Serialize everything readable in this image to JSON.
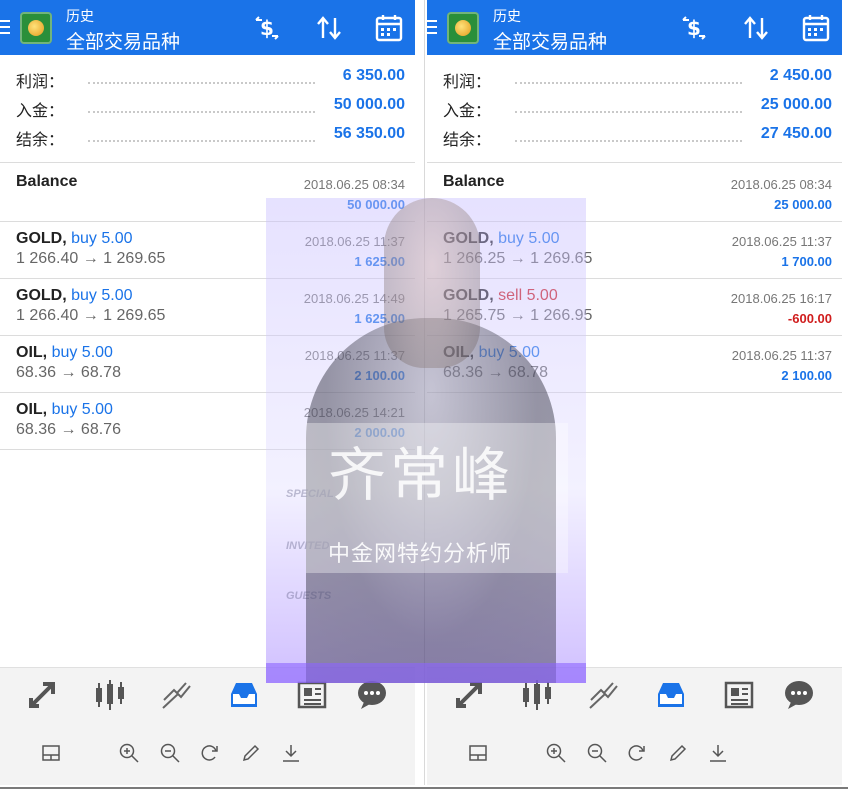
{
  "panels": [
    {
      "header": {
        "subtitle": "历史",
        "title": "全部交易品种"
      },
      "summary": [
        {
          "label": "利润：",
          "value": "6 350.00"
        },
        {
          "label": "入金：",
          "value": "50 000.00"
        },
        {
          "label": "结余：",
          "value": "56 350.00"
        }
      ],
      "deals": [
        {
          "symbol": "Balance",
          "side": "",
          "prices": "",
          "time": "2018.06.25 08:34",
          "profit": "50 000.00",
          "profit_color": "blue",
          "side_color": "blue"
        },
        {
          "symbol": "GOLD,",
          "side": "buy 5.00",
          "prices": "1 266.40 → 1 269.65",
          "time": "2018.06.25 11:37",
          "profit": "1 625.00",
          "profit_color": "blue",
          "side_color": "blue"
        },
        {
          "symbol": "GOLD,",
          "side": "buy 5.00",
          "prices": "1 266.40 → 1 269.65",
          "time": "2018.06.25 14:49",
          "profit": "1 625.00",
          "profit_color": "blue",
          "side_color": "blue"
        },
        {
          "symbol": "OIL,",
          "side": "buy 5.00",
          "prices": "68.36 → 68.78",
          "time": "2018.06.25 11:37",
          "profit": "2 100.00",
          "profit_color": "blue",
          "side_color": "blue"
        },
        {
          "symbol": "OIL,",
          "side": "buy 5.00",
          "prices": "68.36 → 68.76",
          "time": "2018.06.25 14:21",
          "profit": "2 000.00",
          "profit_color": "blue",
          "side_color": "blue"
        }
      ]
    },
    {
      "header": {
        "subtitle": "历史",
        "title": "全部交易品种"
      },
      "summary": [
        {
          "label": "利润：",
          "value": "2 450.00"
        },
        {
          "label": "入金：",
          "value": "25 000.00"
        },
        {
          "label": "结余：",
          "value": "27 450.00"
        }
      ],
      "deals": [
        {
          "symbol": "Balance",
          "side": "",
          "prices": "",
          "time": "2018.06.25 08:34",
          "profit": "25 000.00",
          "profit_color": "blue",
          "side_color": "blue"
        },
        {
          "symbol": "GOLD,",
          "side": "buy 5.00",
          "prices": "1 266.25 → 1 269.65",
          "time": "2018.06.25 11:37",
          "profit": "1 700.00",
          "profit_color": "blue",
          "side_color": "blue"
        },
        {
          "symbol": "GOLD,",
          "side": "sell 5.00",
          "prices": "1 265.75 → 1 266.95",
          "time": "2018.06.25 16:17",
          "profit": "-600.00",
          "profit_color": "red",
          "side_color": "red"
        },
        {
          "symbol": "OIL,",
          "side": "buy 5.00",
          "prices": "68.36 → 68.78",
          "time": "2018.06.25 11:37",
          "profit": "2 100.00",
          "profit_color": "blue",
          "side_color": "blue"
        }
      ]
    }
  ],
  "icons": {
    "header": [
      "currency-swap-icon",
      "sort-icon",
      "calendar-icon"
    ],
    "tabs": [
      "trade-icon",
      "chart-icon",
      "trends-icon",
      "history-icon",
      "news-icon",
      "chat-icon"
    ],
    "tools": [
      "layout-icon",
      "zoom-in-icon",
      "zoom-out-icon",
      "refresh-icon",
      "edit-icon",
      "download-icon"
    ],
    "active_tab": "history-icon"
  },
  "watermark": {
    "name": "齐常峰",
    "caption": "中金网特约分析师",
    "side_words": [
      "SPECIAL",
      "INVITED",
      "GUESTS"
    ]
  },
  "colors": {
    "header": "#1a73e8",
    "accent": "#1a73e8",
    "loss": "#d01d1d"
  }
}
